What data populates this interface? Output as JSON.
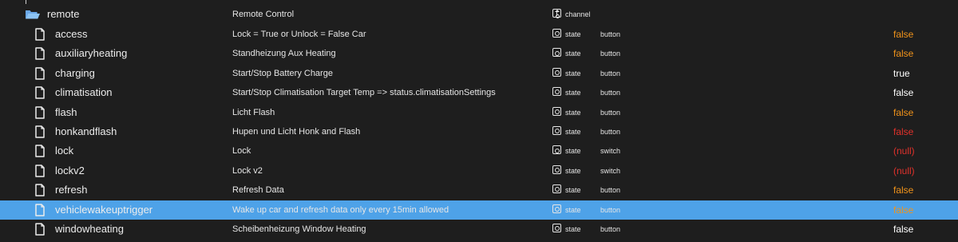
{
  "colors": {
    "background": "#1e1e1e",
    "selection": "#4ea2e8",
    "value_false": "#f0931b",
    "value_true": "#ffffff",
    "value_false_red": "#e0312b",
    "value_null": "#e0312b",
    "value_false_white": "#ffffff"
  },
  "icons": {
    "folder": "folder-open-icon",
    "file": "file-icon",
    "channel": "channel-icon",
    "state": "state-icon"
  },
  "folder": {
    "name": "remote",
    "description": "Remote Control",
    "type": "channel"
  },
  "rows": [
    {
      "name": "access",
      "description": "Lock = True or Unlock = False Car",
      "type": "state",
      "role": "button",
      "value": "false"
    },
    {
      "name": "auxiliaryheating",
      "description": "Standheizung Aux Heating",
      "type": "state",
      "role": "button",
      "value": "false"
    },
    {
      "name": "charging",
      "description": "Start/Stop Battery Charge",
      "type": "state",
      "role": "button",
      "value": "true"
    },
    {
      "name": "climatisation",
      "description": "Start/Stop Climatisation Target Temp => status.climatisationSettings",
      "type": "state",
      "role": "button",
      "value": "false"
    },
    {
      "name": "flash",
      "description": "Licht Flash",
      "type": "state",
      "role": "button",
      "value": "false"
    },
    {
      "name": "honkandflash",
      "description": "Hupen und Licht Honk and Flash",
      "type": "state",
      "role": "button",
      "value": "false"
    },
    {
      "name": "lock",
      "description": "Lock",
      "type": "state",
      "role": "switch",
      "value": "(null)"
    },
    {
      "name": "lockv2",
      "description": "Lock v2",
      "type": "state",
      "role": "switch",
      "value": "(null)"
    },
    {
      "name": "refresh",
      "description": "Refresh Data",
      "type": "state",
      "role": "button",
      "value": "false"
    },
    {
      "name": "vehiclewakeuptrigger",
      "description": "Wake up car and refresh data only every 15min allowed",
      "type": "state",
      "role": "button",
      "value": "false",
      "selected": true
    },
    {
      "name": "windowheating",
      "description": "Scheibenheizung Window Heating",
      "type": "state",
      "role": "button",
      "value": "false"
    }
  ]
}
